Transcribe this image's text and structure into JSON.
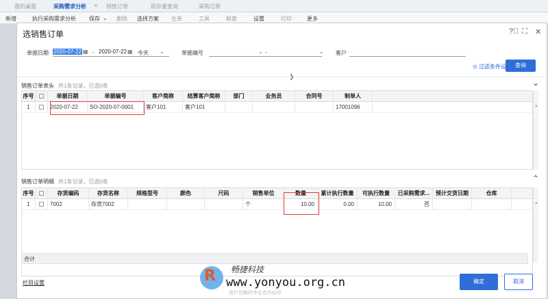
{
  "tabs": [
    "我的桌面",
    "采购需求分析",
    "销售订单",
    "现存量查询",
    "采购订单"
  ],
  "toolbar": [
    "新增",
    "执行采购需求分析",
    "保存",
    "删除",
    "选择方案",
    "生单",
    "工具",
    "联查",
    "设置",
    "打印",
    "更多"
  ],
  "modal": {
    "title": "选销售订单",
    "filters": {
      "date_label": "单据日期",
      "date_from": "2020-07-22",
      "date_sep": "-",
      "date_to": "2020-07-22",
      "date_range": "今天",
      "docno_label": "单据编号",
      "docno_sep": "-",
      "customer_label": "客户",
      "filter_link": "过滤条件设置",
      "query_button": "查询"
    },
    "header_section": {
      "title": "销售订单表头",
      "count": "共1条记录，已选0条",
      "columns": [
        "序号",
        "",
        "单据日期",
        "单据编号",
        "客户简称",
        "结算客户简称",
        "部门",
        "业务员",
        "合同号",
        "制单人"
      ],
      "rows": [
        [
          "1",
          "",
          "2020-07-22",
          "SO-2020-07-0001",
          "客户101",
          "客户101",
          "",
          "",
          "",
          "17001096"
        ]
      ]
    },
    "detail_section": {
      "title": "销售订单明细",
      "count": "共1条记录，已选0条",
      "columns": [
        "序号",
        "",
        "存货编码",
        "存货名称",
        "规格型号",
        "颜色",
        "尺码",
        "销售单位",
        "数量",
        "累计执行数量",
        "可执行数量",
        "已采购需求...",
        "预计交货日期",
        "仓库"
      ],
      "rows": [
        [
          "1",
          "",
          "7002",
          "存货7002",
          "",
          "",
          "",
          "个",
          "10.00",
          "0.00",
          "10.00",
          "否",
          "",
          ""
        ]
      ]
    },
    "total_label": "合计",
    "column_settings": "栏目设置",
    "ok_button": "确定",
    "cancel_button": "取消"
  },
  "watermark": {
    "letter": "R",
    "cn": "畅捷科技",
    "url": "www.yonyou.org.cn",
    "sub": "用户信赖的专业合作伙伴"
  }
}
